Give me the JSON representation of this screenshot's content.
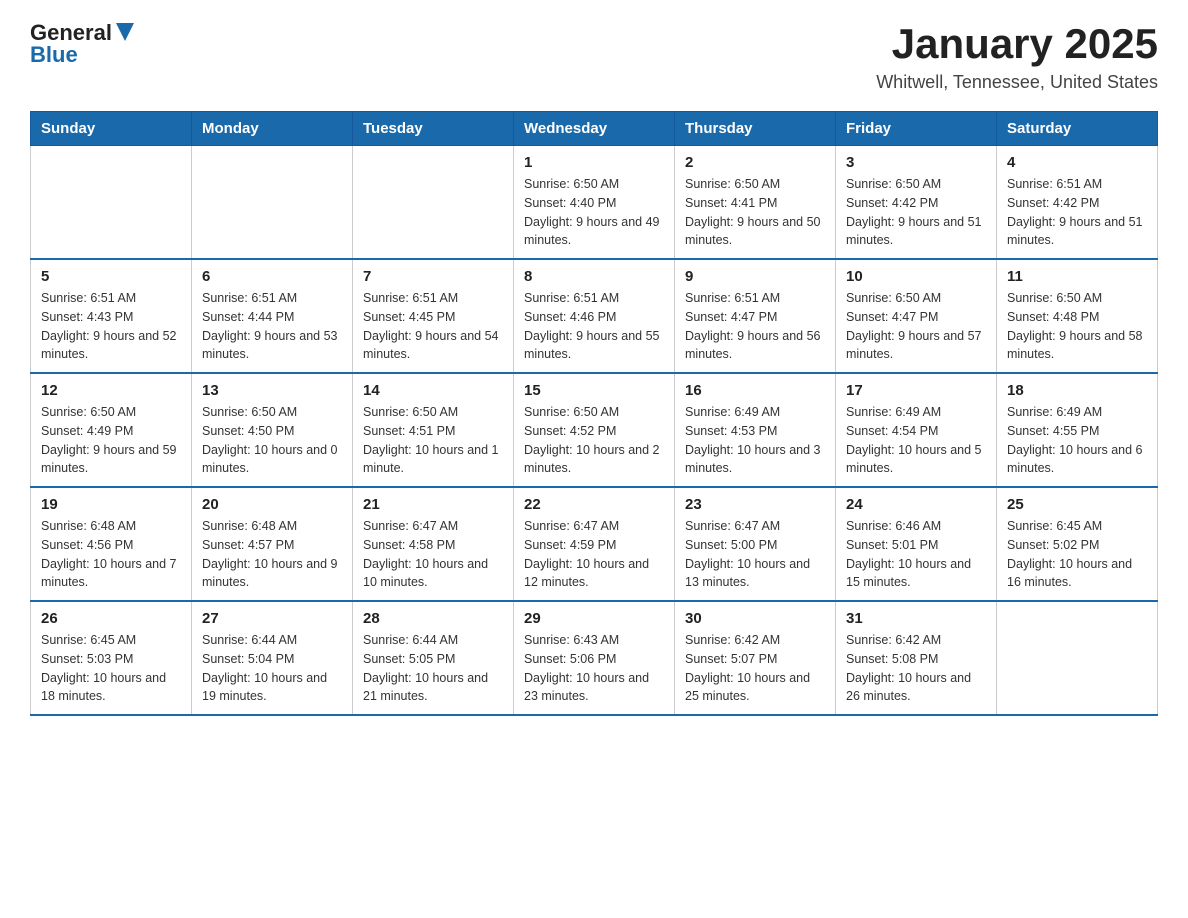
{
  "header": {
    "logo": {
      "text_general": "General",
      "text_blue": "Blue",
      "arrow": "▶"
    },
    "title": "January 2025",
    "subtitle": "Whitwell, Tennessee, United States"
  },
  "calendar": {
    "days_of_week": [
      "Sunday",
      "Monday",
      "Tuesday",
      "Wednesday",
      "Thursday",
      "Friday",
      "Saturday"
    ],
    "weeks": [
      [
        {
          "day": "",
          "info": ""
        },
        {
          "day": "",
          "info": ""
        },
        {
          "day": "",
          "info": ""
        },
        {
          "day": "1",
          "info": "Sunrise: 6:50 AM\nSunset: 4:40 PM\nDaylight: 9 hours and 49 minutes."
        },
        {
          "day": "2",
          "info": "Sunrise: 6:50 AM\nSunset: 4:41 PM\nDaylight: 9 hours and 50 minutes."
        },
        {
          "day": "3",
          "info": "Sunrise: 6:50 AM\nSunset: 4:42 PM\nDaylight: 9 hours and 51 minutes."
        },
        {
          "day": "4",
          "info": "Sunrise: 6:51 AM\nSunset: 4:42 PM\nDaylight: 9 hours and 51 minutes."
        }
      ],
      [
        {
          "day": "5",
          "info": "Sunrise: 6:51 AM\nSunset: 4:43 PM\nDaylight: 9 hours and 52 minutes."
        },
        {
          "day": "6",
          "info": "Sunrise: 6:51 AM\nSunset: 4:44 PM\nDaylight: 9 hours and 53 minutes."
        },
        {
          "day": "7",
          "info": "Sunrise: 6:51 AM\nSunset: 4:45 PM\nDaylight: 9 hours and 54 minutes."
        },
        {
          "day": "8",
          "info": "Sunrise: 6:51 AM\nSunset: 4:46 PM\nDaylight: 9 hours and 55 minutes."
        },
        {
          "day": "9",
          "info": "Sunrise: 6:51 AM\nSunset: 4:47 PM\nDaylight: 9 hours and 56 minutes."
        },
        {
          "day": "10",
          "info": "Sunrise: 6:50 AM\nSunset: 4:47 PM\nDaylight: 9 hours and 57 minutes."
        },
        {
          "day": "11",
          "info": "Sunrise: 6:50 AM\nSunset: 4:48 PM\nDaylight: 9 hours and 58 minutes."
        }
      ],
      [
        {
          "day": "12",
          "info": "Sunrise: 6:50 AM\nSunset: 4:49 PM\nDaylight: 9 hours and 59 minutes."
        },
        {
          "day": "13",
          "info": "Sunrise: 6:50 AM\nSunset: 4:50 PM\nDaylight: 10 hours and 0 minutes."
        },
        {
          "day": "14",
          "info": "Sunrise: 6:50 AM\nSunset: 4:51 PM\nDaylight: 10 hours and 1 minute."
        },
        {
          "day": "15",
          "info": "Sunrise: 6:50 AM\nSunset: 4:52 PM\nDaylight: 10 hours and 2 minutes."
        },
        {
          "day": "16",
          "info": "Sunrise: 6:49 AM\nSunset: 4:53 PM\nDaylight: 10 hours and 3 minutes."
        },
        {
          "day": "17",
          "info": "Sunrise: 6:49 AM\nSunset: 4:54 PM\nDaylight: 10 hours and 5 minutes."
        },
        {
          "day": "18",
          "info": "Sunrise: 6:49 AM\nSunset: 4:55 PM\nDaylight: 10 hours and 6 minutes."
        }
      ],
      [
        {
          "day": "19",
          "info": "Sunrise: 6:48 AM\nSunset: 4:56 PM\nDaylight: 10 hours and 7 minutes."
        },
        {
          "day": "20",
          "info": "Sunrise: 6:48 AM\nSunset: 4:57 PM\nDaylight: 10 hours and 9 minutes."
        },
        {
          "day": "21",
          "info": "Sunrise: 6:47 AM\nSunset: 4:58 PM\nDaylight: 10 hours and 10 minutes."
        },
        {
          "day": "22",
          "info": "Sunrise: 6:47 AM\nSunset: 4:59 PM\nDaylight: 10 hours and 12 minutes."
        },
        {
          "day": "23",
          "info": "Sunrise: 6:47 AM\nSunset: 5:00 PM\nDaylight: 10 hours and 13 minutes."
        },
        {
          "day": "24",
          "info": "Sunrise: 6:46 AM\nSunset: 5:01 PM\nDaylight: 10 hours and 15 minutes."
        },
        {
          "day": "25",
          "info": "Sunrise: 6:45 AM\nSunset: 5:02 PM\nDaylight: 10 hours and 16 minutes."
        }
      ],
      [
        {
          "day": "26",
          "info": "Sunrise: 6:45 AM\nSunset: 5:03 PM\nDaylight: 10 hours and 18 minutes."
        },
        {
          "day": "27",
          "info": "Sunrise: 6:44 AM\nSunset: 5:04 PM\nDaylight: 10 hours and 19 minutes."
        },
        {
          "day": "28",
          "info": "Sunrise: 6:44 AM\nSunset: 5:05 PM\nDaylight: 10 hours and 21 minutes."
        },
        {
          "day": "29",
          "info": "Sunrise: 6:43 AM\nSunset: 5:06 PM\nDaylight: 10 hours and 23 minutes."
        },
        {
          "day": "30",
          "info": "Sunrise: 6:42 AM\nSunset: 5:07 PM\nDaylight: 10 hours and 25 minutes."
        },
        {
          "day": "31",
          "info": "Sunrise: 6:42 AM\nSunset: 5:08 PM\nDaylight: 10 hours and 26 minutes."
        },
        {
          "day": "",
          "info": ""
        }
      ]
    ]
  }
}
